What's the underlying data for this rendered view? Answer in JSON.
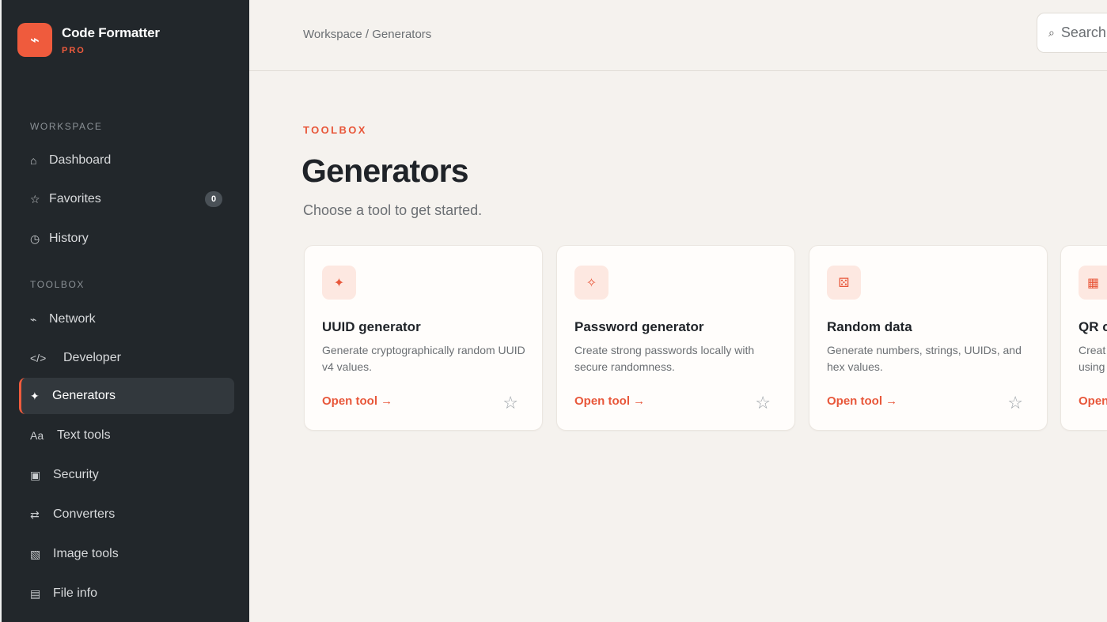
{
  "brand": {
    "name": "Code Formatter",
    "tier": "PRO",
    "logo_icon": "⌁"
  },
  "sidebar": {
    "sections": [
      {
        "label": "WORKSPACE"
      },
      {
        "label": "TOOLBOX"
      }
    ],
    "items": [
      {
        "label": "Dashboard",
        "icon": "⌂",
        "icon_name": "home-icon"
      },
      {
        "label": "Favorites",
        "icon": "☆",
        "icon_name": "star-icon",
        "badge": "0"
      },
      {
        "label": "History",
        "icon": "◷",
        "icon_name": "clock-icon"
      },
      {
        "label": "Network",
        "icon": "⌁",
        "icon_name": "network-icon"
      },
      {
        "label": "Developer",
        "icon": "</>",
        "icon_name": "code-icon"
      },
      {
        "label": "Generators",
        "icon": "✦",
        "icon_name": "sparkle-icon",
        "active": true
      },
      {
        "label": "Text tools",
        "icon": "Aa",
        "icon_name": "text-icon"
      },
      {
        "label": "Security",
        "icon": "▣",
        "icon_name": "shield-icon"
      },
      {
        "label": "Converters",
        "icon": "⇄",
        "icon_name": "swap-icon"
      },
      {
        "label": "Image tools",
        "icon": "▧",
        "icon_name": "image-icon"
      },
      {
        "label": "File info",
        "icon": "▤",
        "icon_name": "file-icon"
      }
    ]
  },
  "topbar": {
    "breadcrumb": "Workspace / Generators",
    "search": {
      "icon": "⌕",
      "placeholder": "Search"
    }
  },
  "main": {
    "eyebrow": "TOOLBOX",
    "title": "Generators",
    "subtitle": "Choose a tool to get started."
  },
  "cards": [
    {
      "title": "UUID generator",
      "description": "Generate cryptographically random UUID v4 values.",
      "link": "Open tool →",
      "icon": "✦",
      "icon_name": "sparkle-icon",
      "star": "☆"
    },
    {
      "title": "Password generator",
      "description": "Create strong passwords locally with secure randomness.",
      "link": "Open tool →",
      "icon": "✧",
      "icon_name": "key-sparkle-icon",
      "star": "☆"
    },
    {
      "title": "Random data",
      "description": "Generate numbers, strings, UUIDs, and hex values.",
      "link": "Open tool →",
      "icon": "⚄",
      "icon_name": "dice-icon",
      "star": "☆"
    },
    {
      "title": "QR c",
      "description": "Creat using",
      "link": "Open",
      "icon": "▦",
      "icon_name": "qr-code-icon",
      "star": "☆"
    }
  ],
  "colors": {
    "accent": "#ef5b3d",
    "sidebar_bg": "#22272b",
    "page_bg": "#f5f2ee"
  }
}
